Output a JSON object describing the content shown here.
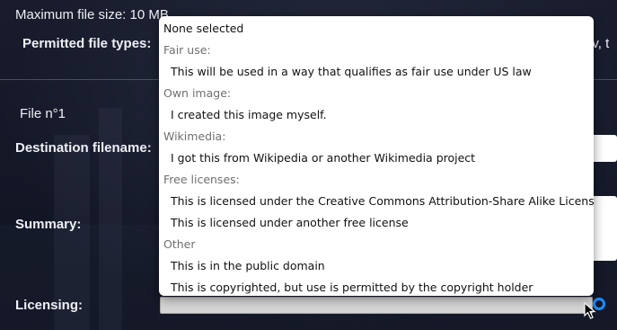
{
  "form": {
    "max_file_size_label": "Maximum file size: 10 MB",
    "permitted_types_label": "Permitted file types:",
    "permitted_types_overflow": "av, t",
    "file_section_title": "File n°1",
    "destination_label": "Destination filename:",
    "summary_label": "Summary:",
    "licensing_label": "Licensing:"
  },
  "licensing_dropdown": {
    "selected": "None selected",
    "none_option": "None selected",
    "groups": [
      {
        "label": "Fair use:",
        "options": [
          "This will be used in a way that qualifies as fair use under US law"
        ]
      },
      {
        "label": "Own image:",
        "options": [
          "I created this image myself."
        ]
      },
      {
        "label": "Wikimedia:",
        "options": [
          "I got this from Wikipedia or another Wikimedia project"
        ]
      },
      {
        "label": "Free licenses:",
        "options": [
          "This is licensed under the Creative Commons Attribution-Share Alike License",
          "This is licensed under another free license"
        ]
      },
      {
        "label": "Other",
        "options": [
          "This is in the public domain",
          "This is copyrighted, but use is permitted by the copyright holder"
        ]
      }
    ]
  },
  "colors": {
    "background": "#15192a",
    "focus_ring": "#1a8cff",
    "group_label": "#6f6f6f"
  }
}
